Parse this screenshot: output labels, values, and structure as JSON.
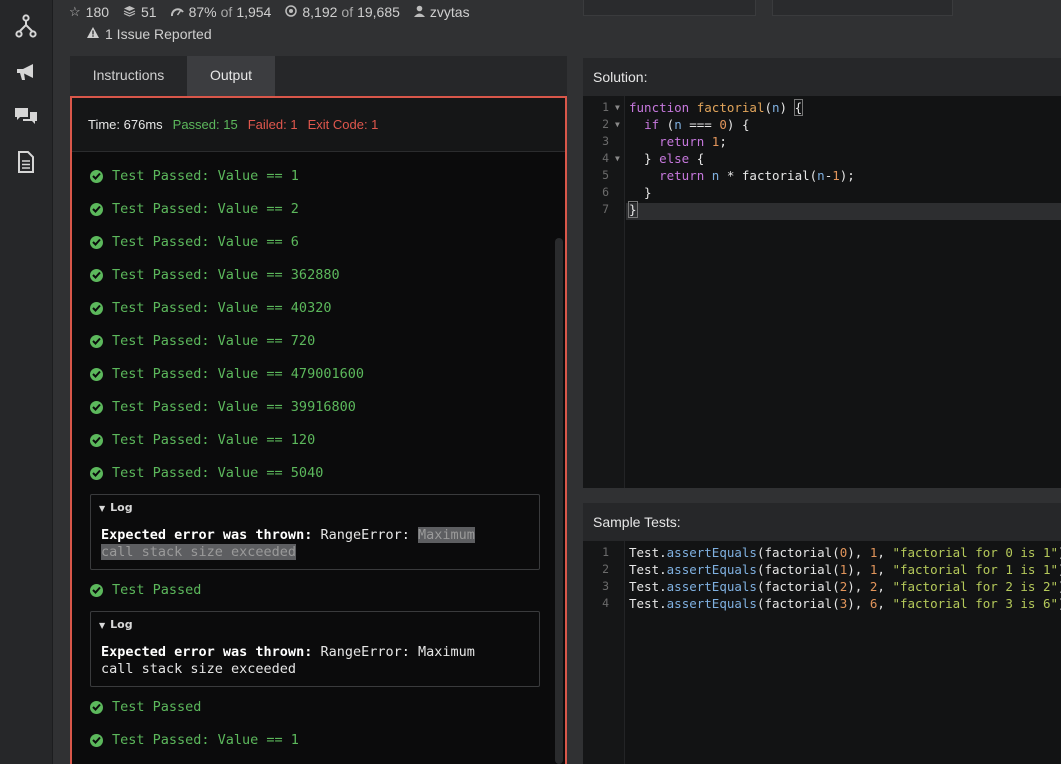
{
  "rail": {
    "icons": [
      "kata-fork-icon",
      "megaphone-icon",
      "chat-icon",
      "document-icon"
    ]
  },
  "stats": {
    "stars": "180",
    "collections": "51",
    "satisfaction": "87%",
    "satisfaction_of": "of",
    "satisfaction_total": "1,954",
    "completed": "8,192",
    "completed_of": "of",
    "completed_total": "19,685",
    "author": "zvytas",
    "issues": "1 Issue Reported"
  },
  "tabs": {
    "instructions": "Instructions",
    "output": "Output",
    "active": "Output"
  },
  "output": {
    "time": "Time: 676ms",
    "passed": "Passed: 15",
    "failed": "Failed: 1",
    "exit_code": "Exit Code: 1",
    "results": [
      "Test Passed: Value == 1",
      "Test Passed: Value == 2",
      "Test Passed: Value == 6",
      "Test Passed: Value == 362880",
      "Test Passed: Value == 40320",
      "Test Passed: Value == 720",
      "Test Passed: Value == 479001600",
      "Test Passed: Value == 39916800",
      "Test Passed: Value == 120",
      "Test Passed: Value == 5040"
    ],
    "log1": {
      "title": "Log",
      "bold": "Expected error was thrown:",
      "text": "RangeError:",
      "highlight1": "Maximum",
      "highlight2": "call stack size exceeded"
    },
    "passed_after_log1": "Test Passed",
    "log2": {
      "title": "Log",
      "bold": "Expected error was thrown:",
      "text": "RangeError: Maximum",
      "text2": "call stack size exceeded"
    },
    "passed_after_log2": "Test Passed",
    "last_result": "Test Passed: Value == 1"
  },
  "solution": {
    "title": "Solution:",
    "line_numbers": [
      "1",
      "2",
      "3",
      "4",
      "5",
      "6",
      "7"
    ]
  },
  "sample_tests": {
    "title": "Sample Tests:",
    "line_numbers": [
      "1",
      "2",
      "3",
      "4"
    ]
  },
  "colors": {
    "pass": "#5cb85c",
    "fail": "#e0574d",
    "output_border": "#d9574a"
  }
}
